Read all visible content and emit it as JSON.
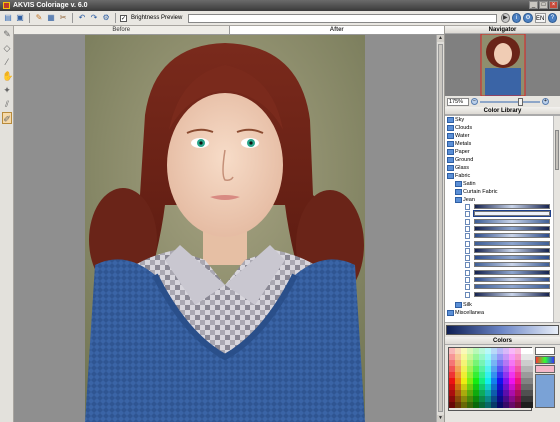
{
  "app": {
    "title": "AKVIS Coloriage v. 6.0"
  },
  "window_buttons": {
    "minimize": "_",
    "maximize": "□",
    "close": "×"
  },
  "toolbar": {
    "brightness_preview_label": "Brightness Preview",
    "brightness_preview_checked": true,
    "language": "EN"
  },
  "tabs": {
    "before": "Before",
    "after": "After"
  },
  "navigator": {
    "title": "Navigator",
    "zoom": "175%"
  },
  "color_library": {
    "title": "Color Library",
    "items": [
      {
        "label": "Sky",
        "level": 0
      },
      {
        "label": "Clouds",
        "level": 0
      },
      {
        "label": "Water",
        "level": 0
      },
      {
        "label": "Metals",
        "level": 0
      },
      {
        "label": "Paper",
        "level": 0
      },
      {
        "label": "Ground",
        "level": 0
      },
      {
        "label": "Glass",
        "level": 0
      },
      {
        "label": "Fabric",
        "level": 0
      },
      {
        "label": "Satin",
        "level": 1
      },
      {
        "label": "Curtain Fabric",
        "level": 1
      },
      {
        "label": "Jean",
        "level": 1
      }
    ],
    "after_items": [
      {
        "label": "Silk",
        "level": 1
      },
      {
        "label": "Miscellanea",
        "level": 0
      }
    ]
  },
  "colors_panel": {
    "title": "Colors"
  },
  "colors": {
    "accent": "#4a7fc1",
    "jean_dark": "#1a2c66",
    "jean_light": "#a8b8d8"
  }
}
